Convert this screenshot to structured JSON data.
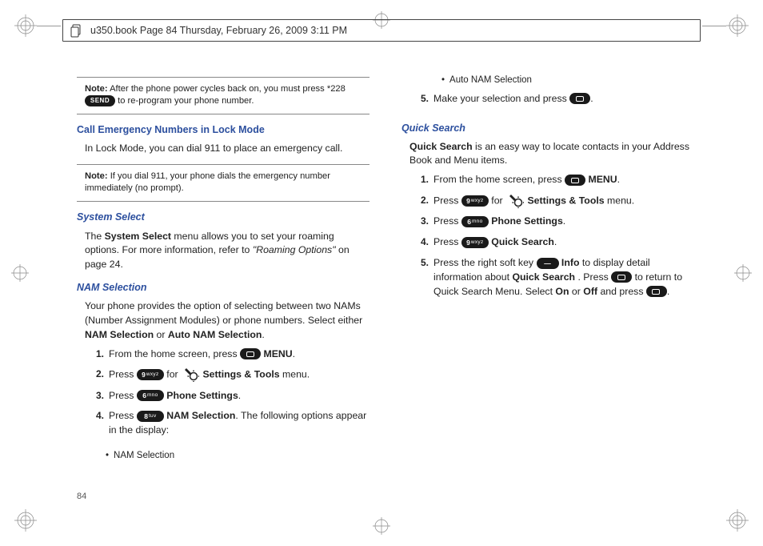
{
  "header": {
    "title": "u350.book  Page 84  Thursday, February 26, 2009  3:11 PM"
  },
  "pagefoot": "84",
  "icons": {
    "send": "SEND",
    "ok": "OK",
    "nine": "9",
    "nine_sub": "wxyz",
    "six": "6",
    "six_sub": "mno",
    "eight": "8",
    "eight_sub": "tuv"
  },
  "left": {
    "note1_label": "Note:",
    "note1": "After the phone power cycles back on, you must press *228 ",
    "note1_tail": " to re-program your phone number.",
    "h_call": "Call Emergency Numbers in Lock Mode",
    "call_body": "In Lock Mode, you can dial 911 to place an emergency call.",
    "note2_label": "Note:",
    "note2": "If you dial 911, your phone dials the emergency number immediately (no prompt).",
    "h_sys": "System Select",
    "sys_body1": "The ",
    "sys_bold": "System Select",
    "sys_body2": " menu allows you to set your roaming options. For more information, refer to ",
    "sys_ital": "\"Roaming Options\"",
    "sys_body3": "  on page 24.",
    "h_nam": "NAM Selection",
    "nam_body1": "Your phone provides the option of selecting between two NAMs (Number Assignment Modules) or phone numbers. Select either ",
    "nam_b1": "NAM Selection",
    "nam_mid": " or ",
    "nam_b2": "Auto NAM Selection",
    "nam_end": ".",
    "s1a": "From the home screen, press ",
    "s1b": " MENU",
    "s1c": ".",
    "s2a": "Press  ",
    "s2b": "  for ",
    "s2c": " Settings & Tools",
    "s2d": " menu.",
    "s3a": "Press ",
    "s3b": " Phone Settings",
    "s3c": ".",
    "s4a": "Press ",
    "s4b": " NAM Selection",
    "s4c": ". The following options appear in the display:",
    "bul1": "NAM Selection"
  },
  "right": {
    "bul2": "Auto NAM Selection",
    "s5a": "Make your selection and press ",
    "s5b": ".",
    "h_qs": "Quick Search",
    "qs_body_b": "Quick Search",
    "qs_body": " is an easy way to locate contacts in your Address Book and Menu items.",
    "r1a": "From the home screen, press ",
    "r1b": " MENU",
    "r1c": ".",
    "r2a": "Press  ",
    "r2b": "  for ",
    "r2c": " Settings & Tools",
    "r2d": " menu.",
    "r3a": "Press ",
    "r3b": " Phone Settings",
    "r3c": ".",
    "r4a": "Press ",
    "r4b": " Quick Search",
    "r4c": ".",
    "r5a": "Press the right soft key ",
    "r5b": " Info",
    "r5c": " to display detail information about ",
    "r5d": "Quick Search",
    "r5e": ". Press ",
    "r5f": " to return to Quick Search Menu. Select ",
    "r5g": "On",
    "r5h": " or ",
    "r5i": "Off",
    "r5j": " and press ",
    "r5k": "."
  }
}
